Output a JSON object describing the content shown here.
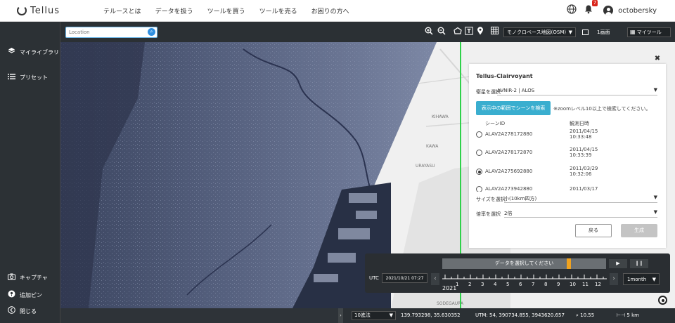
{
  "app": {
    "logo_text": "Tellus",
    "nav": [
      "テルースとは",
      "データを扱う",
      "ツールを買う",
      "ツールを売る",
      "お困りの方へ"
    ],
    "notification_count": "7",
    "username": "octobersky"
  },
  "sidebar": {
    "items_top": [
      {
        "label": "マイライブラリ",
        "icon": "layers-icon"
      },
      {
        "label": "プリセット",
        "icon": "list-icon"
      }
    ],
    "items_bottom": [
      {
        "label": "キャプチャ",
        "icon": "camera-icon"
      },
      {
        "label": "追加ピン",
        "icon": "pin-icon"
      },
      {
        "label": "閉じる",
        "icon": "chevron-left-icon"
      }
    ]
  },
  "maptool": {
    "location_placeholder": "Location",
    "basemap": "モノクロベース地図(OSM)",
    "zoom_label": "1画面",
    "mytool_label": "マイツール"
  },
  "panel": {
    "title": "Tellus-Clairvoyant",
    "satellite_label": "衛星を選択",
    "satellite_value": "AVNIR-2 | ALOS",
    "search_button": "表示中の範囲でシーンを検索",
    "hint": "※zoomレベル10以上で検索してください。",
    "col_scene_id": "シーンID",
    "col_datetime": "観測日時",
    "scenes": [
      {
        "id": "ALAV2A278172880",
        "date": "2011/04/15",
        "time": "10:33:48",
        "selected": false
      },
      {
        "id": "ALAV2A278172870",
        "date": "2011/04/15",
        "time": "10:33:39",
        "selected": false
      },
      {
        "id": "ALAV2A275692880",
        "date": "2011/03/29",
        "time": "10:32:06",
        "selected": true
      },
      {
        "id": "ALAV2A273942880",
        "date": "2011/03/17",
        "time": "",
        "selected": false
      }
    ],
    "size_label": "サイズを選択",
    "size_value": "小(10km四方)",
    "scale_label": "倍率を選択",
    "scale_value": "2倍",
    "back_button": "戻る",
    "create_button": "生成"
  },
  "timeline": {
    "bar_text": "データを選択してください",
    "play": "▶",
    "pause": "❙❙",
    "utc_label": "UTC",
    "datetime": "2021/10/21 07:27",
    "year": "2021",
    "months": [
      "1",
      "2",
      "3",
      "4",
      "5",
      "6",
      "7",
      "8",
      "9",
      "10",
      "11",
      "12"
    ],
    "interval": "1month",
    "current_month_fraction": 0.79
  },
  "statusbar": {
    "notation": "10進法",
    "coords": "139.793298, 35.630352",
    "utm": "UTM: 54, 390734.855, 3943620.657",
    "zoom": "10.55",
    "scale": "5 km"
  },
  "map_labels": [
    "KIHAWA",
    "KAWA",
    "URAYASU",
    "SODEGAURA"
  ]
}
